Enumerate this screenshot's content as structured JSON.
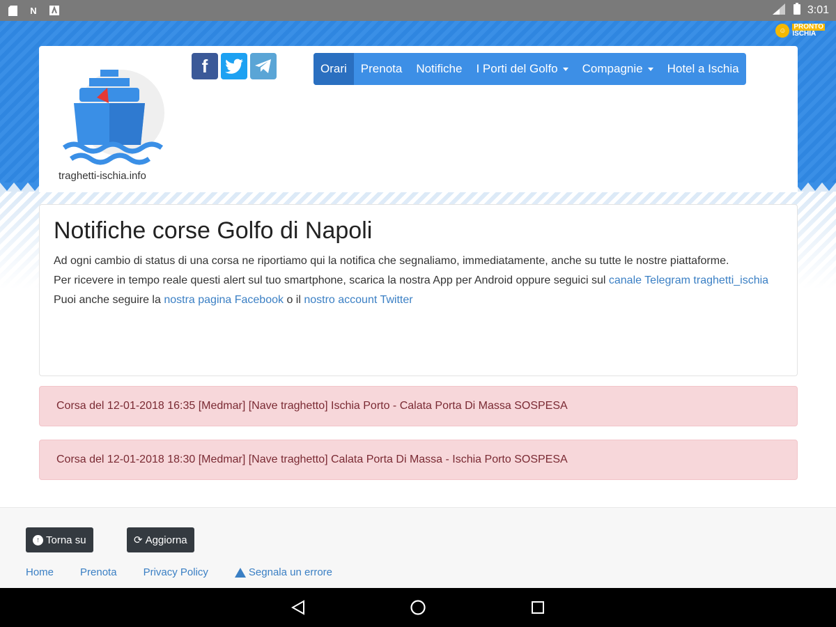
{
  "statusbar": {
    "time": "3:01",
    "left_icons": [
      "file-icon",
      "n-icon",
      "a-icon"
    ],
    "right_icons": [
      "signal-icon",
      "battery-icon"
    ]
  },
  "brand_badge": {
    "line1": "PRONTO",
    "line2": "ISCHIA"
  },
  "header": {
    "logo_text": "traghetti-ischia.info",
    "social": [
      {
        "name": "facebook",
        "glyph": "f"
      },
      {
        "name": "twitter",
        "glyph": "t"
      },
      {
        "name": "telegram",
        "glyph": "➤"
      }
    ],
    "nav": [
      {
        "label": "Orari",
        "active": true,
        "dropdown": false
      },
      {
        "label": "Prenota",
        "active": false,
        "dropdown": false
      },
      {
        "label": "Notifiche",
        "active": false,
        "dropdown": false
      },
      {
        "label": "I Porti del Golfo",
        "active": false,
        "dropdown": true
      },
      {
        "label": "Compagnie",
        "active": false,
        "dropdown": true
      },
      {
        "label": "Hotel a Ischia",
        "active": false,
        "dropdown": false
      }
    ]
  },
  "content": {
    "title": "Notifiche corse Golfo di Napoli",
    "p1": "Ad ogni cambio di status di una corsa ne riportiamo qui la notifica che segnaliamo, immediatamente, anche su tutte le nostre piattaforme.",
    "p2_prefix": "Per ricevere in tempo reale questi alert sul tuo smartphone, scarica la nostra App per Android oppure seguici sul ",
    "p2_link": "canale Telegram traghetti_ischia",
    "p3_prefix": "Puoi anche seguire la ",
    "p3_link1": "nostra pagina Facebook",
    "p3_mid": " o il ",
    "p3_link2": "nostro account Twitter"
  },
  "alerts": [
    "Corsa del 12-01-2018 16:35 [Medmar] [Nave traghetto] Ischia Porto - Calata Porta Di Massa SOSPESA",
    "Corsa del 12-01-2018 18:30 [Medmar] [Nave traghetto] Calata Porta Di Massa - Ischia Porto SOSPESA"
  ],
  "footer": {
    "btn_top": "Torna su",
    "btn_refresh": "Aggiorna",
    "links": [
      "Home",
      "Prenota",
      "Privacy Policy",
      "Segnala un errore"
    ]
  },
  "colors": {
    "nav_bg": "#3d8fe6",
    "nav_active": "#2a6fc0",
    "alert_bg": "#f7d7da",
    "link": "#3a7fc4"
  }
}
